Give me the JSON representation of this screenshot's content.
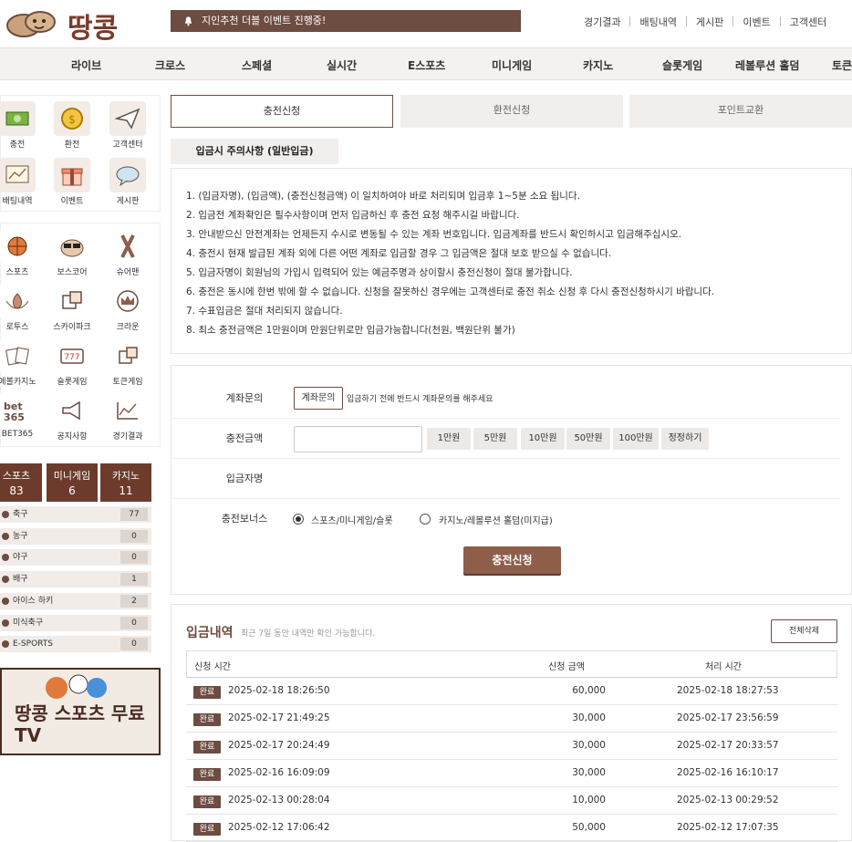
{
  "header": {
    "logo_text": "땅콩",
    "notice": "지인추천 더블 이벤트 진행중!",
    "links": [
      "경기결과",
      "배팅내역",
      "게시판",
      "이벤트",
      "고객센터"
    ]
  },
  "nav": [
    "라이브",
    "크로스",
    "스페셜",
    "실시간",
    "E스포츠",
    "미니게임",
    "카지노",
    "슬롯게임",
    "레볼루션 홀덤",
    "토큰"
  ],
  "sidebar": {
    "quick1": [
      {
        "label": "충전",
        "icon": "cash-icon"
      },
      {
        "label": "환전",
        "icon": "coin-icon"
      },
      {
        "label": "고객센터",
        "icon": "paper-plane-icon"
      },
      {
        "label": "배팅내역",
        "icon": "chart-board-icon"
      },
      {
        "label": "이벤트",
        "icon": "gift-icon"
      },
      {
        "label": "게시판",
        "icon": "speech-bubble-icon"
      }
    ],
    "quick2": [
      {
        "label": "스포츠",
        "icon": "basketball-icon"
      },
      {
        "label": "보스코어",
        "icon": "sunglasses-icon"
      },
      {
        "label": "슈어맨",
        "icon": "ribbon-icon"
      },
      {
        "label": "로투스",
        "icon": "lotus-icon"
      },
      {
        "label": "스카이파크",
        "icon": "dice-icon"
      },
      {
        "label": "크라운",
        "icon": "crown-icon"
      },
      {
        "label": "에볼카지노",
        "icon": "cards-icon"
      },
      {
        "label": "슬롯게임",
        "icon": "slot-icon"
      },
      {
        "label": "토큰게임",
        "icon": "dice-icon"
      },
      {
        "label": "BET365",
        "icon": "bet365-logo"
      },
      {
        "label": "공지사항",
        "icon": "megaphone-icon"
      },
      {
        "label": "경기결과",
        "icon": "line-chart-icon"
      }
    ],
    "category_tabs": [
      {
        "label": "스포츠",
        "count": "83"
      },
      {
        "label": "미니게임",
        "count": "6"
      },
      {
        "label": "카지노",
        "count": "11"
      }
    ],
    "sports": [
      {
        "label": "축구",
        "count": "77"
      },
      {
        "label": "농구",
        "count": "0"
      },
      {
        "label": "야구",
        "count": "0"
      },
      {
        "label": "배구",
        "count": "1"
      },
      {
        "label": "아이스 하키",
        "count": "2"
      },
      {
        "label": "미식축구",
        "count": "0"
      },
      {
        "label": "E-SPORTS",
        "count": "0"
      }
    ],
    "banner_text": "땅콩 스포츠 무료 TV"
  },
  "tabs": [
    "충전신청",
    "환전신청",
    "포인트교환"
  ],
  "subtitle": "입금시 주의사항 (일반입금)",
  "rules": [
    "1. (입금자명), (입금액), (충전신청금액) 이 일치하여야 바로 처리되며 입금후 1~5분 소요 됩니다.",
    "2. 입금전 계좌확인은 필수사항이며 먼저 입금하신 후 충전 요청 해주시길 바랍니다.",
    "3. 안내받으신 안전계좌는 언제든지 수시로 변동될 수 있는 계좌 번호입니다. 입금계좌를 반드시 확인하시고 입금해주십시오.",
    "4. 충전시 현재 발급된 계좌 외에 다른 어떤 계좌로 입금할 경우 그 입금액은 절대 보호 받으실 수 없습니다.",
    "5. 입금자명이 회원님의 가입시 입력되어 있는 예금주명과 상이할시 충전신청이 절대 불가합니다.",
    "6. 충전은 동시에 한번 밖에 할 수 없습니다. 신청을 잘못하신 경우에는 고객센터로 충전 취소 신청 후 다시 충전신청하시기 바랍니다.",
    "7. 수표입금은 절대 처리되지 않습니다.",
    "8. 최소 충전금액은 1만원이며 만원단위로만 입금가능합니다(천원, 백원단위 불가)"
  ],
  "form": {
    "account_label": "계좌문의",
    "account_button": "계좌문의",
    "account_hint": "입금하기 전에 반드시 계좌문의를 해주세요",
    "amount_label": "충전금액",
    "amount_value": "",
    "amount_buttons": [
      "1만원",
      "5만원",
      "10만원",
      "50만원",
      "100만원",
      "정정하기"
    ],
    "depositor_label": "입금자명",
    "bonus_label": "충전보너스",
    "bonus_options": [
      "스포츠/미니게임/슬롯",
      "카지노/레볼루션 홀덤(미지급)"
    ],
    "bonus_selected": 0,
    "submit": "충전신청"
  },
  "history": {
    "title": "입금내역",
    "subtitle": "최근 7일 동안 내역만 확인 가능합니다.",
    "delete_all": "전체삭제",
    "columns": [
      "신청 시간",
      "신청 금액",
      "처리 시간"
    ],
    "rows": [
      {
        "status": "완료",
        "requested": "2025-02-18 18:26:50",
        "amount": "60,000",
        "processed": "2025-02-18 18:27:53"
      },
      {
        "status": "완료",
        "requested": "2025-02-17 21:49:25",
        "amount": "30,000",
        "processed": "2025-02-17 23:56:59"
      },
      {
        "status": "완료",
        "requested": "2025-02-17 20:24:49",
        "amount": "30,000",
        "processed": "2025-02-17 20:33:57"
      },
      {
        "status": "완료",
        "requested": "2025-02-16 16:09:09",
        "amount": "30,000",
        "processed": "2025-02-16 16:10:17"
      },
      {
        "status": "완료",
        "requested": "2025-02-13 00:28:04",
        "amount": "10,000",
        "processed": "2025-02-13 00:29:52"
      },
      {
        "status": "완료",
        "requested": "2025-02-12 17:06:42",
        "amount": "50,000",
        "processed": "2025-02-12 17:07:35"
      }
    ]
  }
}
